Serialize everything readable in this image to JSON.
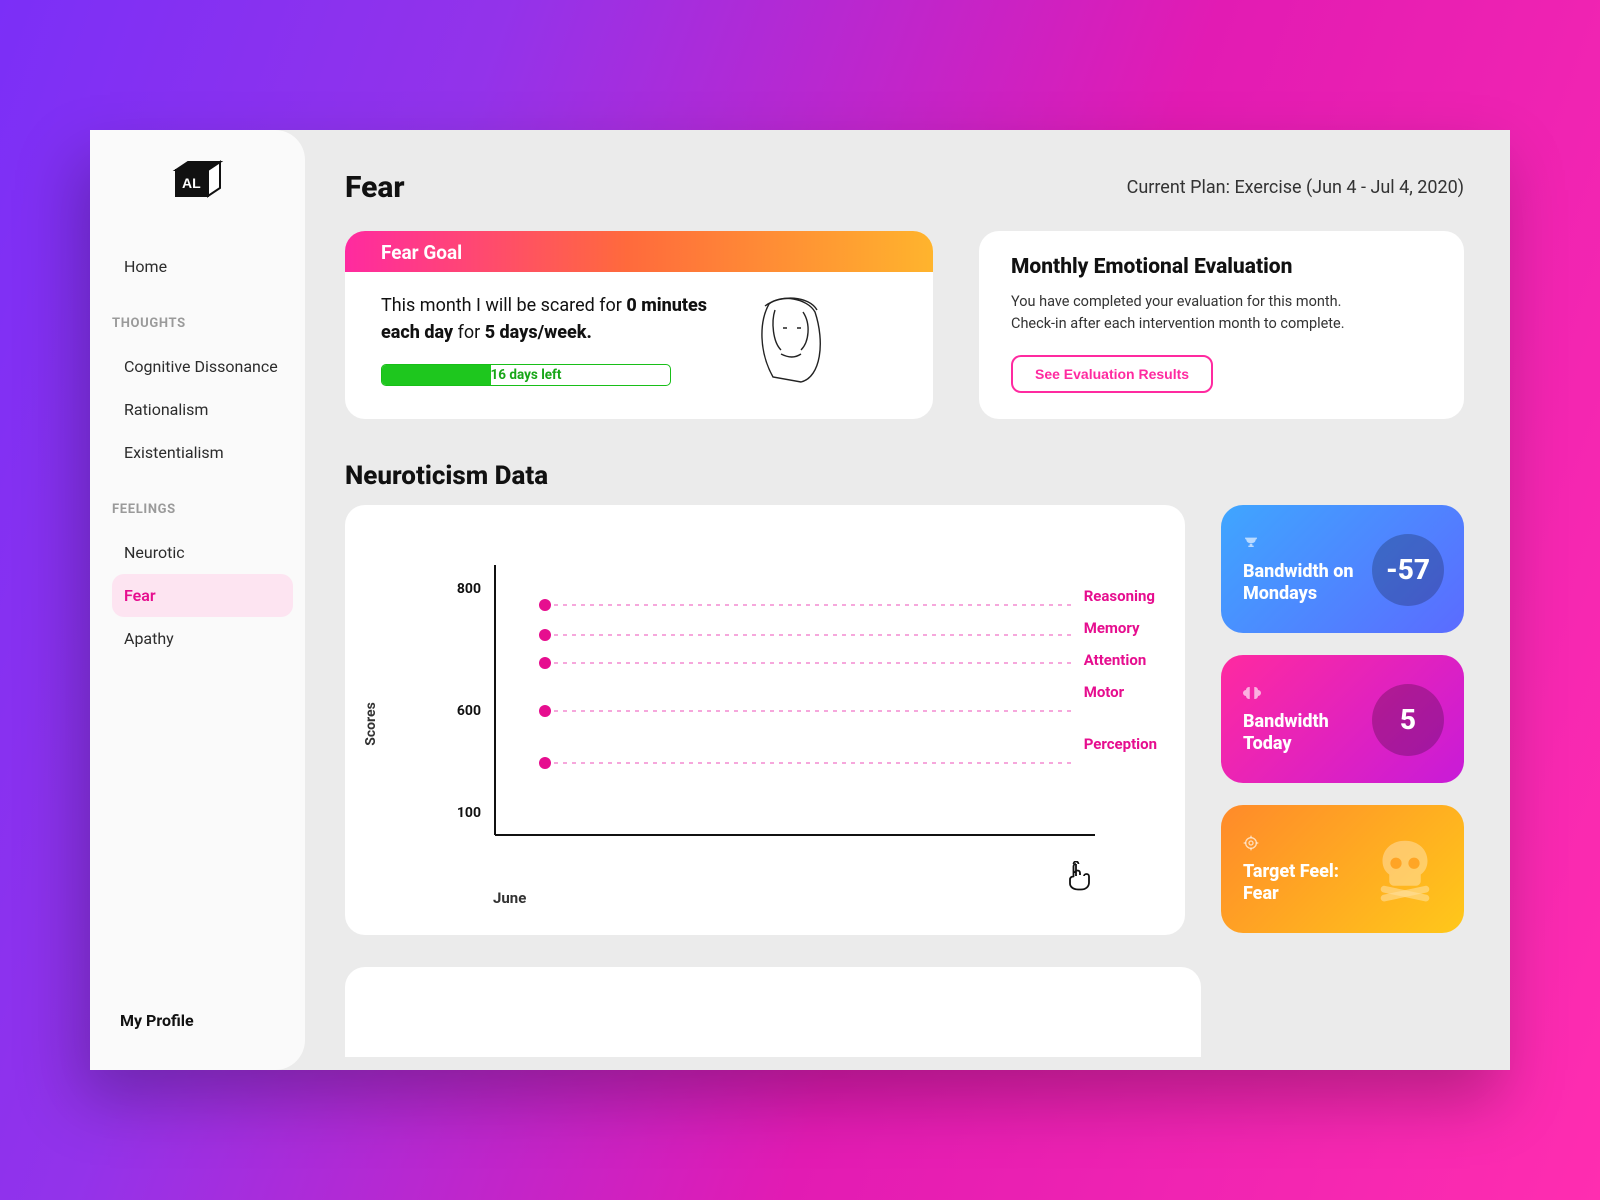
{
  "sidebar": {
    "logo_text": "AL",
    "home": "Home",
    "section_thoughts": "THOUGHTS",
    "thoughts": [
      "Cognitive Dissonance",
      "Rationalism",
      "Existentialism"
    ],
    "section_feelings": "FEELINGS",
    "feelings": [
      "Neurotic",
      "Fear",
      "Apathy"
    ],
    "active_feeling_index": 1,
    "profile": "My Profile"
  },
  "header": {
    "title": "Fear",
    "plan": "Current Plan: Exercise (Jun 4 - Jul 4, 2020)"
  },
  "goal": {
    "header": "Fear Goal",
    "sentence_prefix": "This month I will be scared for ",
    "minutes": "0 minutes each day",
    "mid": " for ",
    "days": "5 days/week.",
    "progress_pct": 38,
    "progress_label": "16 days left"
  },
  "evaluation": {
    "title": "Monthly Emotional Evaluation",
    "desc": "You have completed your evaluation for this month. Check-in after each intervention month to complete.",
    "button": "See Evaluation Results"
  },
  "section_title": "Neuroticism Data",
  "chart_data": {
    "type": "scatter",
    "ylabel": "Scores",
    "xlabel": "June",
    "y_ticks": [
      100,
      600,
      800
    ],
    "ylim": [
      0,
      850
    ],
    "series": [
      {
        "name": "Reasoning",
        "x": [
          "June"
        ],
        "y": [
          750
        ]
      },
      {
        "name": "Memory",
        "x": [
          "June"
        ],
        "y": [
          700
        ]
      },
      {
        "name": "Attention",
        "x": [
          "June"
        ],
        "y": [
          660
        ]
      },
      {
        "name": "Motor",
        "x": [
          "June"
        ],
        "y": [
          600
        ]
      },
      {
        "name": "Perception",
        "x": [
          "June"
        ],
        "y": [
          500
        ]
      }
    ]
  },
  "stats": {
    "blue": {
      "icon": "trophy-icon",
      "label": "Bandwidth on Mondays",
      "value": "-57"
    },
    "pink": {
      "icon": "brain-icon",
      "label": "Bandwidth Today",
      "value": "5"
    },
    "orange": {
      "icon": "target-icon",
      "label": "Target Feel: Fear"
    }
  },
  "colors": {
    "accent_pink": "#ff2aa0",
    "accent_green": "#1ec71e"
  }
}
